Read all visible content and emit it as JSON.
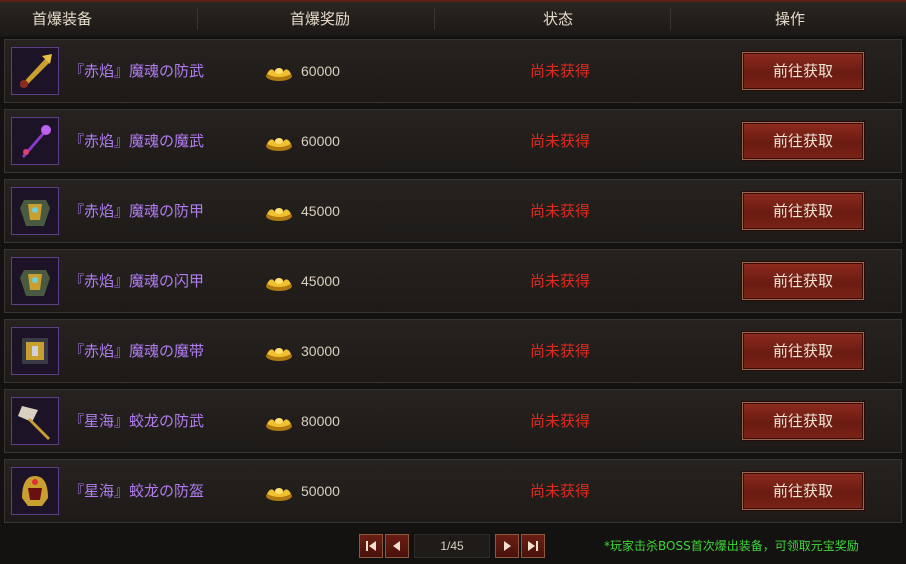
{
  "header": {
    "col_item": "首爆装备",
    "col_reward": "首爆奖励",
    "col_status": "状态",
    "col_action": "操作"
  },
  "rows": [
    {
      "name": "『赤焰』魔魂の防武",
      "reward": "60000",
      "status": "尚未获得",
      "action": "前往获取",
      "icon": "sword-icon"
    },
    {
      "name": "『赤焰』魔魂の魔武",
      "reward": "60000",
      "status": "尚未获得",
      "action": "前往获取",
      "icon": "staff-icon"
    },
    {
      "name": "『赤焰』魔魂の防甲",
      "reward": "45000",
      "status": "尚未获得",
      "action": "前往获取",
      "icon": "armor-icon"
    },
    {
      "name": "『赤焰』魔魂の闪甲",
      "reward": "45000",
      "status": "尚未获得",
      "action": "前往获取",
      "icon": "armor-icon"
    },
    {
      "name": "『赤焰』魔魂の魔带",
      "reward": "30000",
      "status": "尚未获得",
      "action": "前往获取",
      "icon": "belt-icon"
    },
    {
      "name": "『星海』蛟龙の防武",
      "reward": "80000",
      "status": "尚未获得",
      "action": "前往获取",
      "icon": "axe-icon"
    },
    {
      "name": "『星海』蛟龙の防盔",
      "reward": "50000",
      "status": "尚未获得",
      "action": "前往获取",
      "icon": "helmet-icon"
    }
  ],
  "pagination": {
    "page": "1/45",
    "first": "⏮",
    "prev": "◀",
    "next": "▶",
    "last": "⏭"
  },
  "tip": "*玩家击杀BOSS首次爆出装备，可领取元宝奖励",
  "colors": {
    "item_name": "#b07cf0",
    "status": "#e02a20",
    "tip": "#3ed63a",
    "button": "#7a2216"
  }
}
